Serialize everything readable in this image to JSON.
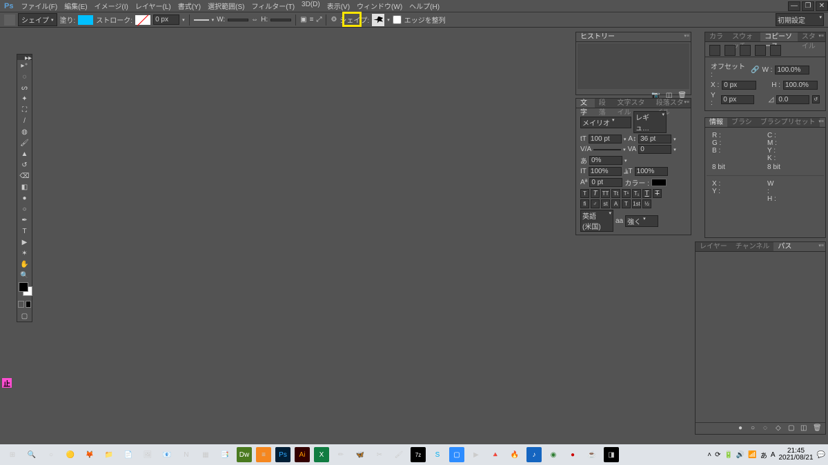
{
  "app": {
    "logo": "Ps"
  },
  "menu": {
    "file": "ファイル(F)",
    "edit": "編集(E)",
    "image": "イメージ(I)",
    "layer": "レイヤー(L)",
    "type": "書式(Y)",
    "select": "選択範囲(S)",
    "filter": "フィルター(T)",
    "threeD": "3D(D)",
    "view": "表示(V)",
    "window": "ウィンドウ(W)",
    "help": "ヘルプ(H)"
  },
  "opt": {
    "shape_mode": "シェイプ",
    "fill_label": "塗り:",
    "stroke_label": "ストローク:",
    "stroke_size": "0 px",
    "w_label": "W:",
    "h_label": "H:",
    "shape_label": "シェイプ:",
    "align_edges": "エッジを整列",
    "workspace": "初期設定"
  },
  "panels": {
    "history": {
      "title": "ヒストリー"
    },
    "char": {
      "tab_text": "文字",
      "tab_para": "段落",
      "tab_textstyle": "文字スタイル",
      "tab_parastyle": "段落スタイル",
      "font": "メイリオ",
      "style": "レギュ…",
      "size": "100 pt",
      "leading": "36 pt",
      "tracking": "0",
      "tsume": "0%",
      "scale_v": "100%",
      "scale_h": "100%",
      "baseline": "0 pt",
      "color_label": "カラー :",
      "lang": "英語 (米国)",
      "aa_label": "aa",
      "aa_value": "強く"
    },
    "color": {
      "tab_color": "カラー",
      "tab_swatch": "スウォッチ",
      "tab_copysrc": "コピーソース",
      "tab_style": "スタイル"
    },
    "copysrc": {
      "offset": "オフセット :",
      "x": "X :",
      "x_val": "0 px",
      "y": "Y :",
      "y_val": "0 px",
      "w": "W :",
      "w_val": "100.0%",
      "h": "H :",
      "h_val": "100.0%",
      "angle_val": "0.0"
    },
    "info": {
      "tab_info": "情報",
      "tab_brush": "ブラシ",
      "tab_brushpreset": "ブラシプリセット",
      "r": "R :",
      "g": "G :",
      "b": "B :",
      "c": "C :",
      "m": "M :",
      "y": "Y :",
      "k": "K :",
      "bits": "8 bit",
      "bits2": "8 bit",
      "x": "X :",
      "y2": "Y :",
      "w": "W :",
      "h": "H :"
    },
    "layers": {
      "tab_layer": "レイヤー",
      "tab_channel": "チャンネル",
      "tab_path": "パス"
    }
  },
  "indicator": "止",
  "taskbar": {
    "time": "21:45",
    "date": "2021/08/21"
  },
  "tray_icons": [
    "chevron",
    "sync",
    "battery",
    "speaker",
    "wifi",
    "ime",
    "a-mode",
    "keyboard"
  ]
}
